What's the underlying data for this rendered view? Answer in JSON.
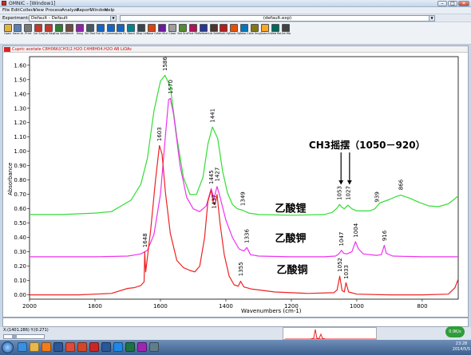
{
  "titlebar": {
    "title": "OMNIC - [Window1]",
    "buttons": {
      "minimize": "–",
      "maximize": "□",
      "close": "✕"
    }
  },
  "menu": [
    "File",
    "Edit",
    "Collect",
    "View",
    "Process",
    "Analyze",
    "Report",
    "Window",
    "Help"
  ],
  "experiment": {
    "label": "Experiment:",
    "value": "Default - Default",
    "window_value": "(default.exp)"
  },
  "toolbar": [
    {
      "label": "Open",
      "icon": "open-icon",
      "color": "#e3b341"
    },
    {
      "label": "Save As",
      "icon": "save-icon",
      "color": "#5a7fb5"
    },
    {
      "label": "Print",
      "icon": "print-icon",
      "color": "#777777"
    },
    {
      "label": "Col Smp",
      "icon": "collect-sample-icon",
      "color": "#c0392b"
    },
    {
      "label": "Col Bkg",
      "icon": "collect-background-icon",
      "color": "#c0392b"
    },
    {
      "label": "Exp Set",
      "icon": "experiment-setup-icon",
      "color": "#2e7d32"
    },
    {
      "label": "Bench",
      "icon": "bench-icon",
      "color": "#6d4c41"
    },
    {
      "label": "Diag",
      "icon": "diagnostic-icon",
      "color": "#8e24aa"
    },
    {
      "label": "Sel Tools",
      "icon": "selection-tool-icon",
      "color": "#455a64"
    },
    {
      "label": "Full Sc",
      "icon": "full-scale-icon",
      "color": "#1565c0"
    },
    {
      "label": "Common",
      "icon": "common-scale-icon",
      "color": "#1565c0"
    },
    {
      "label": "Auto Full",
      "icon": "auto-full-scale-icon",
      "color": "#1565c0"
    },
    {
      "label": "Stack",
      "icon": "stack-spectra-icon",
      "color": "#00838f"
    },
    {
      "label": "Disp Lim",
      "icon": "display-limits-icon",
      "color": "#37474f"
    },
    {
      "label": "Base Cor",
      "icon": "baseline-correct-icon",
      "color": "#d84315"
    },
    {
      "label": "Ser Mul",
      "icon": "subtract-icon",
      "color": "#6a1b9a"
    },
    {
      "label": "Clear",
      "icon": "clear-icon",
      "color": "#9e9e9e"
    },
    {
      "label": "Set Snap",
      "icon": "snapshot-icon",
      "color": "#558b2f"
    },
    {
      "label": "Find Pks",
      "icon": "find-peaks-icon",
      "color": "#ad1457"
    },
    {
      "label": "Reference",
      "icon": "reference-icon",
      "color": "#283593"
    },
    {
      "label": "Lib Setup",
      "icon": "library-setup-icon",
      "color": "#4e342e"
    },
    {
      "label": "Multi Spe",
      "icon": "multi-spectrum-icon",
      "color": "#b71c1c"
    },
    {
      "label": "Tools Opt",
      "icon": "tools-options-icon",
      "color": "#e65100"
    },
    {
      "label": "Data Cap",
      "icon": "data-capture-icon",
      "color": "#0277bd"
    },
    {
      "label": "Lib Srcg",
      "icon": "library-search-icon",
      "color": "#827717"
    },
    {
      "label": "Search",
      "icon": "search-icon",
      "color": "#f9a825"
    },
    {
      "label": "Web Ref",
      "icon": "web-reference-icon",
      "color": "#00695c"
    },
    {
      "label": "Lite Mod",
      "icon": "lite-mode-icon",
      "color": "#424242"
    }
  ],
  "spectrum_window": {
    "header_text": "Cupric acetate   C8H06K(CH3)2.H2O   C4H8H04.H2O   AB   LiOAc"
  },
  "chart_data": {
    "type": "line",
    "xlabel": "Wavenumbers (cm-1)",
    "ylabel": "Absorbance",
    "xlim": [
      2000,
      690
    ],
    "ylim": [
      -0.03,
      1.66
    ],
    "x_ticks": [
      2000,
      1800,
      1600,
      1400,
      1200,
      1000,
      800
    ],
    "y_ticks": [
      0.0,
      0.1,
      0.2,
      0.3,
      0.4,
      0.5,
      0.6,
      0.7,
      0.8,
      0.9,
      1.0,
      1.1,
      1.2,
      1.3,
      1.4,
      1.5,
      1.6
    ],
    "y_tick_labels": [
      "0.00",
      "0.10",
      "0.20",
      "0.30",
      "0.40",
      "0.50",
      "0.60",
      "0.70",
      "0.80",
      "0.90",
      "1.00",
      "1.10",
      "1.20",
      "1.30",
      "1.40",
      "1.50",
      "1.60"
    ],
    "grid": false,
    "series": [
      {
        "name": "乙酸锂",
        "color": "#33dd33",
        "points": [
          [
            2000,
            0.56
          ],
          [
            1900,
            0.56
          ],
          [
            1800,
            0.57
          ],
          [
            1750,
            0.58
          ],
          [
            1720,
            0.62
          ],
          [
            1690,
            0.66
          ],
          [
            1660,
            0.77
          ],
          [
            1640,
            0.95
          ],
          [
            1620,
            1.28
          ],
          [
            1600,
            1.49
          ],
          [
            1586,
            1.53
          ],
          [
            1570,
            1.45
          ],
          [
            1550,
            1.1
          ],
          [
            1530,
            0.82
          ],
          [
            1510,
            0.7
          ],
          [
            1490,
            0.7
          ],
          [
            1470,
            0.82
          ],
          [
            1455,
            1.05
          ],
          [
            1441,
            1.17
          ],
          [
            1425,
            1.09
          ],
          [
            1410,
            0.86
          ],
          [
            1395,
            0.71
          ],
          [
            1380,
            0.63
          ],
          [
            1365,
            0.6
          ],
          [
            1349,
            0.59
          ],
          [
            1330,
            0.57
          ],
          [
            1300,
            0.56
          ],
          [
            1200,
            0.555
          ],
          [
            1100,
            0.56
          ],
          [
            1075,
            0.575
          ],
          [
            1060,
            0.605
          ],
          [
            1053,
            0.63
          ],
          [
            1045,
            0.61
          ],
          [
            1038,
            0.6
          ],
          [
            1027,
            0.625
          ],
          [
            1015,
            0.6
          ],
          [
            1000,
            0.585
          ],
          [
            960,
            0.585
          ],
          [
            945,
            0.6
          ],
          [
            939,
            0.615
          ],
          [
            930,
            0.64
          ],
          [
            900,
            0.665
          ],
          [
            880,
            0.685
          ],
          [
            866,
            0.695
          ],
          [
            840,
            0.675
          ],
          [
            810,
            0.645
          ],
          [
            780,
            0.62
          ],
          [
            750,
            0.615
          ],
          [
            720,
            0.635
          ],
          [
            700,
            0.67
          ],
          [
            690,
            0.69
          ]
        ],
        "label_position": [
          1250,
          0.58
        ]
      },
      {
        "name": "乙酸钾",
        "color": "#ee33ee",
        "points": [
          [
            2000,
            0.265
          ],
          [
            1800,
            0.265
          ],
          [
            1700,
            0.27
          ],
          [
            1660,
            0.285
          ],
          [
            1640,
            0.31
          ],
          [
            1620,
            0.42
          ],
          [
            1600,
            0.7
          ],
          [
            1585,
            1.1
          ],
          [
            1575,
            1.36
          ],
          [
            1570,
            1.37
          ],
          [
            1560,
            1.26
          ],
          [
            1540,
            0.9
          ],
          [
            1520,
            0.68
          ],
          [
            1500,
            0.6
          ],
          [
            1480,
            0.58
          ],
          [
            1460,
            0.62
          ],
          [
            1450,
            0.7
          ],
          [
            1445,
            0.74
          ],
          [
            1440,
            0.7
          ],
          [
            1437,
            0.66
          ],
          [
            1432,
            0.71
          ],
          [
            1427,
            0.755
          ],
          [
            1420,
            0.7
          ],
          [
            1400,
            0.52
          ],
          [
            1380,
            0.4
          ],
          [
            1360,
            0.32
          ],
          [
            1345,
            0.305
          ],
          [
            1336,
            0.33
          ],
          [
            1325,
            0.28
          ],
          [
            1300,
            0.27
          ],
          [
            1200,
            0.265
          ],
          [
            1100,
            0.265
          ],
          [
            1065,
            0.27
          ],
          [
            1055,
            0.285
          ],
          [
            1047,
            0.31
          ],
          [
            1040,
            0.29
          ],
          [
            1030,
            0.285
          ],
          [
            1015,
            0.3
          ],
          [
            1004,
            0.37
          ],
          [
            995,
            0.32
          ],
          [
            980,
            0.285
          ],
          [
            940,
            0.275
          ],
          [
            925,
            0.28
          ],
          [
            916,
            0.345
          ],
          [
            910,
            0.29
          ],
          [
            890,
            0.27
          ],
          [
            800,
            0.265
          ],
          [
            700,
            0.265
          ],
          [
            690,
            0.265
          ]
        ],
        "label_position": [
          1250,
          0.37
        ]
      },
      {
        "name": "乙酸铜",
        "color": "#ee2222",
        "points": [
          [
            2000,
            0.0
          ],
          [
            1850,
            0.0
          ],
          [
            1750,
            0.01
          ],
          [
            1700,
            0.045
          ],
          [
            1680,
            0.05
          ],
          [
            1660,
            0.065
          ],
          [
            1650,
            0.09
          ],
          [
            1648,
            0.3
          ],
          [
            1645,
            0.16
          ],
          [
            1630,
            0.45
          ],
          [
            1615,
            0.8
          ],
          [
            1603,
            1.04
          ],
          [
            1595,
            0.98
          ],
          [
            1585,
            0.72
          ],
          [
            1570,
            0.43
          ],
          [
            1550,
            0.24
          ],
          [
            1530,
            0.19
          ],
          [
            1510,
            0.17
          ],
          [
            1495,
            0.16
          ],
          [
            1480,
            0.2
          ],
          [
            1465,
            0.4
          ],
          [
            1455,
            0.65
          ],
          [
            1445,
            0.73
          ],
          [
            1438,
            0.64
          ],
          [
            1433,
            0.63
          ],
          [
            1427,
            0.7
          ],
          [
            1418,
            0.5
          ],
          [
            1405,
            0.28
          ],
          [
            1390,
            0.13
          ],
          [
            1375,
            0.07
          ],
          [
            1362,
            0.06
          ],
          [
            1355,
            0.095
          ],
          [
            1345,
            0.055
          ],
          [
            1320,
            0.04
          ],
          [
            1250,
            0.02
          ],
          [
            1150,
            0.01
          ],
          [
            1070,
            0.015
          ],
          [
            1060,
            0.035
          ],
          [
            1052,
            0.13
          ],
          [
            1045,
            0.03
          ],
          [
            1038,
            0.02
          ],
          [
            1033,
            0.085
          ],
          [
            1025,
            0.02
          ],
          [
            1000,
            0.005
          ],
          [
            900,
            0.0
          ],
          [
            800,
            0.0
          ],
          [
            720,
            0.005
          ],
          [
            700,
            0.05
          ],
          [
            690,
            0.11
          ]
        ],
        "label_position": [
          1245,
          0.15
        ]
      }
    ],
    "peak_labels": [
      {
        "text": "1586",
        "x": 1586,
        "y": 1.56
      },
      {
        "text": "1570",
        "x": 1570,
        "y": 1.4
      },
      {
        "text": "1603",
        "x": 1603,
        "y": 1.07
      },
      {
        "text": "1441",
        "x": 1441,
        "y": 1.2
      },
      {
        "text": "1445",
        "x": 1445,
        "y": 0.77
      },
      {
        "text": "1427",
        "x": 1427,
        "y": 0.79
      },
      {
        "text": "1437",
        "x": 1437,
        "y": 0.6
      },
      {
        "text": "1648",
        "x": 1648,
        "y": 0.33
      },
      {
        "text": "1349",
        "x": 1349,
        "y": 0.62
      },
      {
        "text": "1336",
        "x": 1336,
        "y": 0.36
      },
      {
        "text": "1355",
        "x": 1355,
        "y": 0.13
      },
      {
        "text": "1053",
        "x": 1053,
        "y": 0.66
      },
      {
        "text": "1027",
        "x": 1027,
        "y": 0.66
      },
      {
        "text": "1047",
        "x": 1047,
        "y": 0.34
      },
      {
        "text": "1004",
        "x": 1004,
        "y": 0.4
      },
      {
        "text": "1052",
        "x": 1052,
        "y": 0.16
      },
      {
        "text": "1033",
        "x": 1033,
        "y": 0.11
      },
      {
        "text": "939",
        "x": 939,
        "y": 0.645
      },
      {
        "text": "916",
        "x": 916,
        "y": 0.375
      },
      {
        "text": "866",
        "x": 866,
        "y": 0.73
      }
    ],
    "annotation": {
      "text": "CH3摇摆（1050－920）",
      "anchor": [
        1000,
        1.02
      ],
      "arrows_to": [
        [
          1053,
          0.67
        ],
        [
          1027,
          0.67
        ]
      ]
    }
  },
  "status": {
    "coords": "X:(1401.286)  Y:(0.271)",
    "thumb_peaks": [
      1052,
      1033
    ]
  },
  "taskbar": {
    "speed": "0.9K/s",
    "time": "23:28\n2014/5/5",
    "icons": [
      {
        "name": "ie-icon",
        "color": "#3b8fe0"
      },
      {
        "name": "folder-icon",
        "color": "#e8b84a"
      },
      {
        "name": "media-icon",
        "color": "#f07d1a"
      },
      {
        "name": "word-icon",
        "color": "#2b5797"
      },
      {
        "name": "chrome-icon",
        "color": "#dd4b39"
      },
      {
        "name": "powerpoint-icon",
        "color": "#d24726"
      },
      {
        "name": "omnic-icon",
        "color": "#c62828"
      },
      {
        "name": "word-icon",
        "color": "#2b5797"
      },
      {
        "name": "explorer-icon",
        "color": "#1e88e5"
      },
      {
        "name": "excel-icon",
        "color": "#1e7145"
      },
      {
        "name": "paint-icon",
        "color": "#9c27b0"
      },
      {
        "name": "app-icon",
        "color": "#607d8b"
      }
    ]
  }
}
